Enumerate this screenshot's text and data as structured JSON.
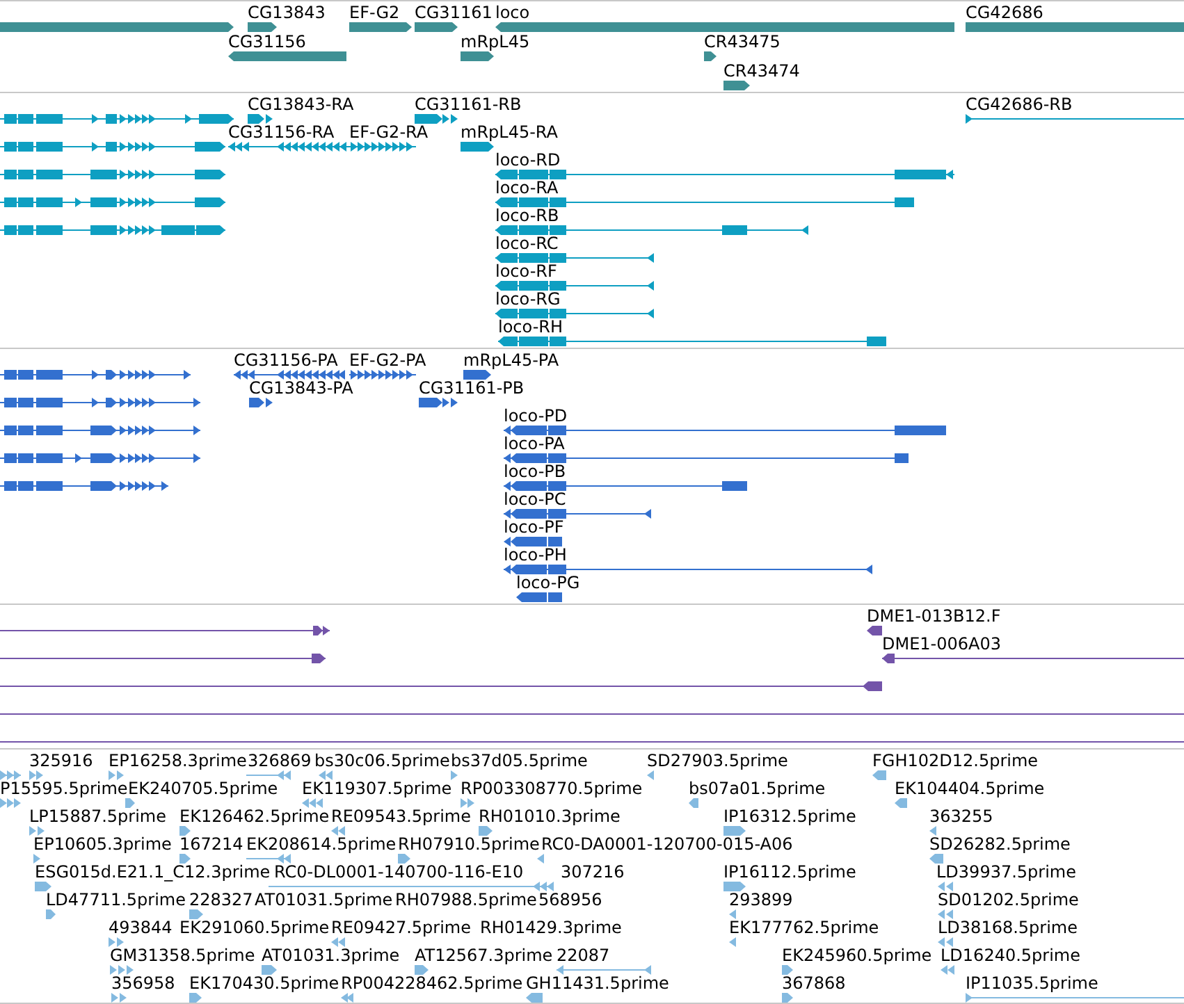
{
  "tracks": [
    {
      "kind": "gene",
      "features": [
        {
          "reverse": false
        },
        {
          "label": "CG13843",
          "reverse": false
        },
        {
          "label": "EF-G2",
          "reverse": false
        },
        {
          "label": "CG31161",
          "reverse": false
        },
        {
          "label": "loco",
          "reverse": true
        },
        {
          "label": "CG42686",
          "reverse": false
        },
        {
          "label": "CG31156",
          "reverse": true
        },
        {
          "label": "mRpL45",
          "reverse": false
        },
        {
          "label": "CR43475",
          "reverse": false
        },
        {
          "label": "CR43474",
          "reverse": false
        }
      ]
    },
    {
      "kind": "transcript",
      "features": [
        {
          "reverse": false
        },
        {
          "label": "CG13843-RA",
          "reverse": false
        },
        {
          "label": "CG31161-RB",
          "reverse": false
        },
        {
          "label": "CG42686-RB",
          "reverse": false
        },
        {
          "reverse": false
        },
        {
          "label": "CG31156-RA",
          "reverse": true
        },
        {
          "label": "EF-G2-RA",
          "reverse": false
        },
        {
          "label": "mRpL45-RA",
          "reverse": false
        },
        {
          "reverse": false
        },
        {
          "label": "loco-RD",
          "reverse": true
        },
        {
          "reverse": false
        },
        {
          "label": "loco-RA",
          "reverse": true
        },
        {
          "reverse": false
        },
        {
          "label": "loco-RB",
          "reverse": true
        },
        {
          "label": "loco-RC",
          "reverse": true
        },
        {
          "label": "loco-RF",
          "reverse": true
        },
        {
          "label": "loco-RG",
          "reverse": true
        },
        {
          "label": "loco-RH",
          "reverse": true
        }
      ]
    },
    {
      "kind": "protein",
      "features": [
        {
          "reverse": false
        },
        {
          "label": "CG31156-PA",
          "reverse": true
        },
        {
          "label": "EF-G2-PA",
          "reverse": false
        },
        {
          "label": "mRpL45-PA",
          "reverse": false
        },
        {
          "reverse": false
        },
        {
          "label": "CG13843-PA",
          "reverse": false
        },
        {
          "label": "CG31161-PB",
          "reverse": false
        },
        {
          "reverse": false
        },
        {
          "label": "loco-PD",
          "reverse": true
        },
        {
          "reverse": false
        },
        {
          "label": "loco-PA",
          "reverse": true
        },
        {
          "reverse": false
        },
        {
          "label": "loco-PB",
          "reverse": true
        },
        {
          "label": "loco-PC",
          "reverse": true
        },
        {
          "label": "loco-PF",
          "reverse": true
        },
        {
          "label": "loco-PH",
          "reverse": true
        },
        {
          "label": "loco-PG",
          "reverse": true
        }
      ]
    },
    {
      "kind": "match",
      "features": [
        {
          "reverse": false
        },
        {
          "label": "DME1-013B12.F",
          "reverse": true
        },
        {
          "reverse": false
        },
        {
          "label": "DME1-006A03",
          "reverse": true
        },
        {
          "reverse": true
        }
      ]
    },
    {
      "kind": "est",
      "features": [
        {
          "reverse": false
        },
        {
          "label": "325916",
          "reverse": false
        },
        {
          "label": "EP16258.3prime",
          "reverse": false
        },
        {
          "label": "326869",
          "reverse": true
        },
        {
          "label": "bs30c06.5prime",
          "reverse": true
        },
        {
          "label": "bs37d05.5prime",
          "reverse": false
        },
        {
          "label": "SD27903.5prime",
          "reverse": true
        },
        {
          "label": "FGH102D12.5prime",
          "reverse": true
        },
        {
          "label": "P15595.5prime",
          "reverse": false
        },
        {
          "label": "EK240705.5prime",
          "reverse": false
        },
        {
          "label": "EK119307.5prime",
          "reverse": true
        },
        {
          "label": "RP003308770.5prime",
          "reverse": false
        },
        {
          "label": "bs07a01.5prime",
          "reverse": true
        },
        {
          "label": "EK104404.5prime",
          "reverse": true
        },
        {
          "label": "LP15887.5prime",
          "reverse": false
        },
        {
          "label": "EK126462.5prime",
          "reverse": false
        },
        {
          "label": "RE09543.5prime",
          "reverse": true
        },
        {
          "label": "RH01010.3prime",
          "reverse": false
        },
        {
          "label": "IP16312.5prime",
          "reverse": false
        },
        {
          "label": "363255",
          "reverse": true
        },
        {
          "label": "EP10605.3prime",
          "reverse": false
        },
        {
          "label": "167214",
          "reverse": false
        },
        {
          "label": "EK208614.5prime",
          "reverse": true
        },
        {
          "label": "RH07910.5prime",
          "reverse": false
        },
        {
          "label": "RC0-DA0001-120700-015-A06",
          "reverse": true
        },
        {
          "label": "SD26282.5prime",
          "reverse": true
        },
        {
          "label": "ESG015d.E21.1_C12.3prime",
          "reverse": false
        },
        {
          "label": "RC0-DL0001-140700-116-E10",
          "reverse": true
        },
        {
          "label": "307216"
        },
        {
          "label": "IP16112.5prime",
          "reverse": false
        },
        {
          "label": "LD39937.5prime",
          "reverse": true
        },
        {
          "label": "LD47711.5prime",
          "reverse": false
        },
        {
          "label": "228327",
          "reverse": false
        },
        {
          "label": "AT01031.5prime"
        },
        {
          "label": "RH07988.5prime"
        },
        {
          "label": "568956"
        },
        {
          "label": "293899",
          "reverse": true
        },
        {
          "label": "SD01202.5prime",
          "reverse": true
        },
        {
          "label": "493844",
          "reverse": false
        },
        {
          "label": "EK291060.5prime"
        },
        {
          "label": "RE09427.5prime",
          "reverse": true
        },
        {
          "label": "RH01429.3prime"
        },
        {
          "label": "EK177762.5prime",
          "reverse": true
        },
        {
          "label": "LD38168.5prime",
          "reverse": true
        },
        {
          "label": "GM31358.5prime",
          "reverse": false
        },
        {
          "label": "AT01031.3prime",
          "reverse": false
        },
        {
          "label": "AT12567.3prime",
          "reverse": false
        },
        {
          "label": "22087",
          "reverse": true
        },
        {
          "label": "EK245960.5prime",
          "reverse": false
        },
        {
          "label": "LD16240.5prime",
          "reverse": true
        },
        {
          "label": "356958",
          "reverse": false
        },
        {
          "label": "EK170430.5prime",
          "reverse": false
        },
        {
          "label": "RP004228462.5prime",
          "reverse": true
        },
        {
          "label": "GH11431.5prime",
          "reverse": true
        },
        {
          "label": "367868",
          "reverse": false
        },
        {
          "label": "IP11035.5prime",
          "reverse": false
        }
      ]
    }
  ]
}
